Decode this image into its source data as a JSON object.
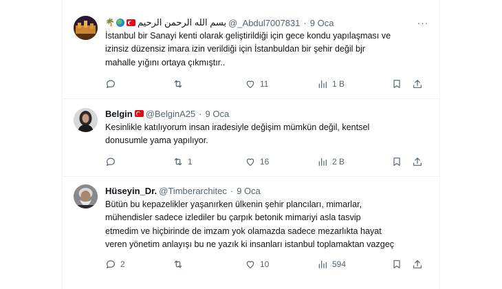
{
  "tweets": [
    {
      "name": "بسم الله الرحمن الرحيم",
      "handle": "@_Abdul7007831",
      "time": "9 Oca",
      "text": "İstanbul bir Sanayi kenti olarak geliştirildiği için gece kondu yapılaşması ve\nizinsiz düzensiz imara izin verildiği için İstanbuldan  bir şehir değil bjr\nmahalle yığını ortaya çıkmıştır..",
      "replies": "",
      "retweets": "",
      "likes": "11",
      "views": "1 B",
      "badges": [
        "palm-tree-icon",
        "globe-icon",
        "turkey-flag-icon"
      ]
    },
    {
      "name": "Belgin",
      "handle": "@BelginA25",
      "time": "9 Oca",
      "text": "Kesinlikle katılıyorum insan iradesiyle değişim mümkün değil, kentsel\ndonusumle yama yapılıyor.",
      "replies": "",
      "retweets": "1",
      "likes": "16",
      "views": "2 B",
      "badges": [
        "turkey-flag-icon"
      ]
    },
    {
      "name": "Hüseyin_Dr.",
      "handle": "@Timberarchitec",
      "time": "9 Oca",
      "text": "Bütün bu kepazelikler yaşanırken ülkenin şehir plancıları, mimarlar,\nmühendisler sadece izlediler bu çarpık betonik mimariyi asla tasvip\netmedim ve hiçbirinde de imzam yok olamazda sadece mezarlıkta hayat\nveren yönetim anlayışı bu ne yazık ki insanları istanbul toplamaktan vazgeç",
      "replies": "2",
      "retweets": "",
      "likes": "10",
      "views": "594",
      "badges": []
    }
  ],
  "colors": {
    "text": "#0f1419",
    "secondary": "#536471",
    "border": "#eff3f4",
    "flag_red": "#e30a17"
  },
  "icons": [
    "reply-icon",
    "retweet-icon",
    "like-icon",
    "views-icon",
    "bookmark-icon",
    "share-icon",
    "more-icon"
  ]
}
